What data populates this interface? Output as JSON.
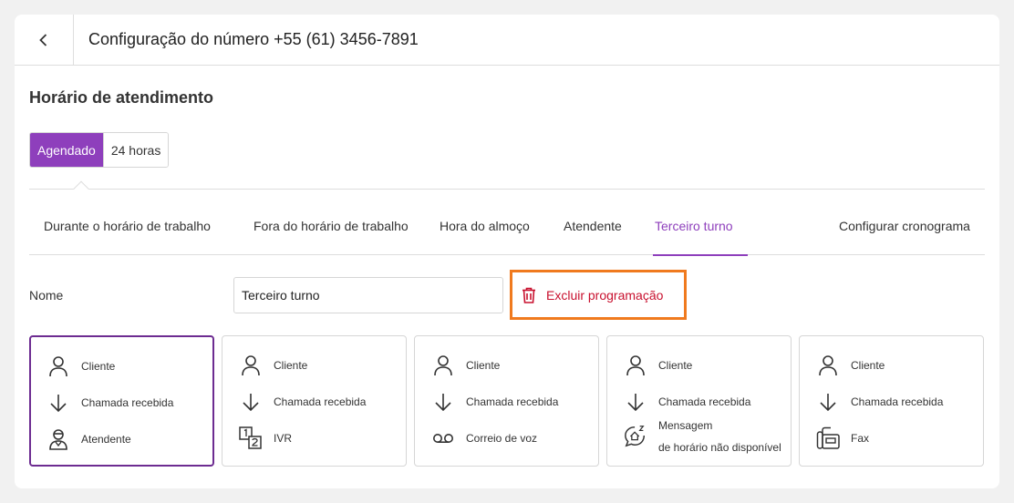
{
  "header": {
    "title": "Configuração do número +55 (61) 3456-7891"
  },
  "section": {
    "title": "Horário de atendimento"
  },
  "mode": {
    "options": [
      "Agendado",
      "24 horas"
    ],
    "selected": "Agendado"
  },
  "tabs": [
    {
      "label": "Durante o horário de trabalho"
    },
    {
      "label": "Fora do horário de trabalho"
    },
    {
      "label": "Hora do almoço"
    },
    {
      "label": "Atendente"
    },
    {
      "label": "Terceiro turno",
      "active": true
    },
    {
      "label": "Configurar cronograma"
    }
  ],
  "form": {
    "name_label": "Nome",
    "name_value": "Terceiro turno",
    "delete_label": "Excluir programação"
  },
  "flows": [
    {
      "step1": "Cliente",
      "step2": "Chamada recebida",
      "step3": "Atendente",
      "icon": "agent-icon",
      "selected": true
    },
    {
      "step1": "Cliente",
      "step2": "Chamada recebida",
      "step3": "IVR",
      "icon": "ivr-icon"
    },
    {
      "step1": "Cliente",
      "step2": "Chamada recebida",
      "step3": "Correio de voz",
      "icon": "voicemail-icon"
    },
    {
      "step1": "Cliente",
      "step2": "Chamada recebida",
      "step3_line1": "Mensagem",
      "step3_line2": "de horário não disponível",
      "icon": "away-message-icon"
    },
    {
      "step1": "Cliente",
      "step2": "Chamada recebida",
      "step3": "Fax",
      "icon": "fax-icon"
    }
  ],
  "colors": {
    "accent": "#8e3fbc",
    "selected_border": "#6d2c91",
    "danger": "#c8102e",
    "highlight": "#f07a1e"
  }
}
